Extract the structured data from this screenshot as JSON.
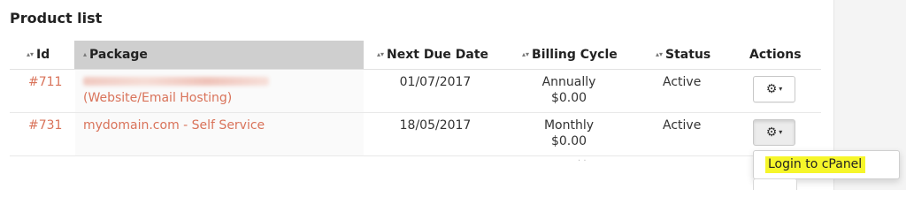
{
  "page": {
    "title": "Product list"
  },
  "table": {
    "columns": [
      {
        "label": "Id",
        "sort": "▴▾"
      },
      {
        "label": "Package",
        "sort": "▴"
      },
      {
        "label": "Next Due Date",
        "sort": "▴▾"
      },
      {
        "label": "Billing Cycle",
        "sort": "▴▾"
      },
      {
        "label": "Status",
        "sort": "▴▾"
      },
      {
        "label": "Actions"
      }
    ],
    "rows": [
      {
        "id": "#711",
        "package_line2": "(Website/Email Hosting)",
        "due_date": "01/07/2017",
        "cycle": "Annually",
        "price": "$0.00",
        "status": "Active"
      },
      {
        "id": "#731",
        "package": "mydomain.com - Self Service",
        "due_date": "18/05/2017",
        "cycle": "Monthly",
        "price": "$0.00",
        "status": "Active"
      }
    ]
  },
  "actions": {
    "gear": "⚙",
    "caret": "▾"
  },
  "dropdown": {
    "items": [
      {
        "label": "Login to cPanel",
        "highlight": "#f6f62a"
      }
    ]
  },
  "colors": {
    "link": "#d9735a",
    "sorted_header": "#cfcfcf"
  }
}
